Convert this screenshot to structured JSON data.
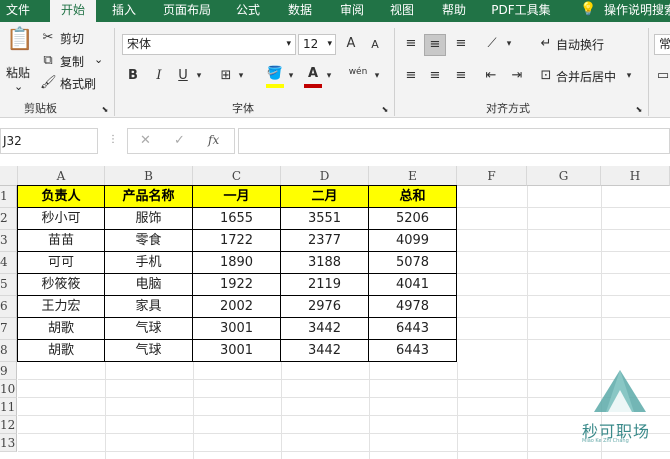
{
  "tabs": [
    "文件",
    "开始",
    "插入",
    "页面布局",
    "公式",
    "数据",
    "审阅",
    "视图",
    "帮助",
    "PDF工具集",
    "操作说明搜索"
  ],
  "clipboard": {
    "paste": "粘贴",
    "cut": "剪切",
    "copy": "复制",
    "format_painter": "格式刷",
    "group": "剪贴板"
  },
  "font": {
    "name": "宋体",
    "size": "12",
    "group": "字体",
    "increase": "A",
    "decrease": "A",
    "bold": "B",
    "italic": "I",
    "underline": "U",
    "font_color": "A",
    "phonetic": "wén"
  },
  "alignment": {
    "wrap": "自动换行",
    "merge": "合并后居中",
    "group": "对齐方式"
  },
  "number": {
    "format": "常"
  },
  "formula_bar": {
    "name_box": "J32",
    "cancel": "✕",
    "enter": "✓",
    "fx": "fx",
    "formula": ""
  },
  "columns": [
    "A",
    "B",
    "C",
    "D",
    "E",
    "F",
    "G",
    "H"
  ],
  "rows": [
    "1",
    "2",
    "3",
    "4",
    "5",
    "6",
    "7",
    "8",
    "9",
    "10",
    "11",
    "12",
    "13"
  ],
  "table": {
    "headers": [
      "负责人",
      "产品名称",
      "一月",
      "二月",
      "总和"
    ],
    "data": [
      [
        "秒小可",
        "服饰",
        "1655",
        "3551",
        "5206"
      ],
      [
        "苗苗",
        "零食",
        "1722",
        "2377",
        "4099"
      ],
      [
        "可可",
        "手机",
        "1890",
        "3188",
        "5078"
      ],
      [
        "秒筱筱",
        "电脑",
        "1922",
        "2119",
        "4041"
      ],
      [
        "王力宏",
        "家具",
        "2002",
        "2976",
        "4978"
      ],
      [
        "胡歌",
        "气球",
        "3001",
        "3442",
        "6443"
      ],
      [
        "胡歌",
        "气球",
        "3001",
        "3442",
        "6443"
      ]
    ]
  },
  "watermark": {
    "text": "秒可职场",
    "sub": "Miao Ke Zhi Chang"
  },
  "colors": {
    "excel_green": "#217346",
    "header_fill": "#ffff00"
  }
}
